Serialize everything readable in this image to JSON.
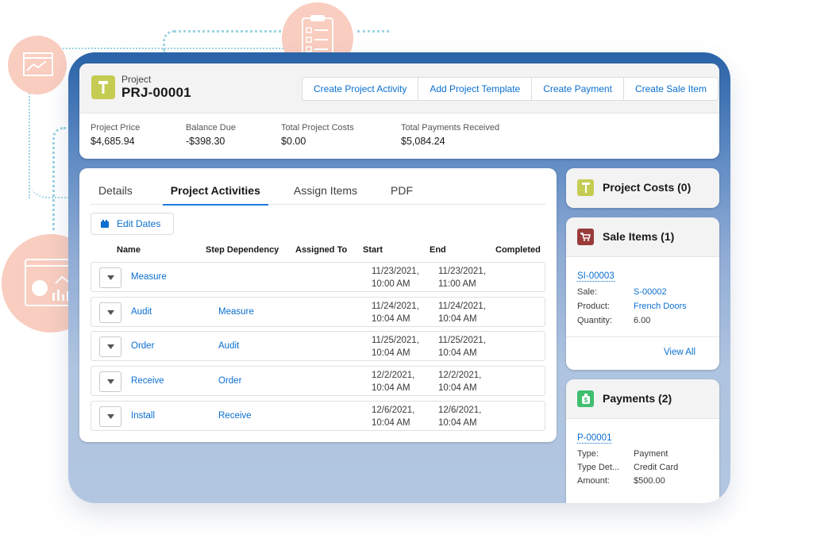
{
  "header": {
    "object_label": "Project",
    "record_name": "PRJ-00001",
    "actions": [
      "Create Project Activity",
      "Add Project Template",
      "Create Payment",
      "Create Sale Item"
    ],
    "fields": [
      {
        "label": "Project Price",
        "value": "$4,685.94"
      },
      {
        "label": "Balance Due",
        "value": "-$398.30"
      },
      {
        "label": "Total Project Costs",
        "value": "$0.00"
      },
      {
        "label": "Total Payments Received",
        "value": "$5,084.24"
      }
    ]
  },
  "tabs": [
    {
      "label": "Details",
      "active": false
    },
    {
      "label": "Project Activities",
      "active": true
    },
    {
      "label": "Assign Items",
      "active": false
    },
    {
      "label": "PDF",
      "active": false
    }
  ],
  "edit_dates_label": "Edit Dates",
  "table": {
    "columns": [
      "Name",
      "Step Dependency",
      "Assigned To",
      "Start",
      "End",
      "Completed"
    ],
    "rows": [
      {
        "name": "Measure",
        "dependency": "",
        "assigned_to": "",
        "start_date": "11/23/2021,",
        "start_time": "10:00 AM",
        "end_date": "11/23/2021,",
        "end_time": "11:00 AM",
        "completed": ""
      },
      {
        "name": "Audit",
        "dependency": "Measure",
        "assigned_to": "",
        "start_date": "11/24/2021,",
        "start_time": "10:04 AM",
        "end_date": "11/24/2021,",
        "end_time": "10:04 AM",
        "completed": ""
      },
      {
        "name": "Order",
        "dependency": "Audit",
        "assigned_to": "",
        "start_date": "11/25/2021,",
        "start_time": "10:04 AM",
        "end_date": "11/25/2021,",
        "end_time": "10:04 AM",
        "completed": ""
      },
      {
        "name": "Receive",
        "dependency": "Order",
        "assigned_to": "",
        "start_date": "12/2/2021,",
        "start_time": "10:04 AM",
        "end_date": "12/2/2021,",
        "end_time": "10:04 AM",
        "completed": ""
      },
      {
        "name": "Install",
        "dependency": "Receive",
        "assigned_to": "",
        "start_date": "12/6/2021,",
        "start_time": "10:04 AM",
        "end_date": "12/6/2021,",
        "end_time": "10:04 AM",
        "completed": ""
      }
    ]
  },
  "sidebar": {
    "project_costs": {
      "title": "Project Costs (0)",
      "icon": "hammer-icon",
      "color": "#c5cc52"
    },
    "sale_items": {
      "title": "Sale Items (1)",
      "icon": "cart-icon",
      "color": "#9a3b3b",
      "record_id": "SI-00003",
      "fields": [
        {
          "label": "Sale:",
          "value": "S-00002",
          "link": true
        },
        {
          "label": "Product:",
          "value": "French Doors",
          "link": true
        },
        {
          "label": "Quantity:",
          "value": "6.00",
          "link": false
        }
      ],
      "view_all": "View All"
    },
    "payments": {
      "title": "Payments (2)",
      "icon": "money-bag-icon",
      "color": "#3fbf6f",
      "record_id": "P-00001",
      "fields": [
        {
          "label": "Type:",
          "value": "Payment"
        },
        {
          "label": "Type Det...",
          "value": "Credit Card"
        },
        {
          "label": "Amount:",
          "value": "$500.00"
        }
      ]
    }
  },
  "colors": {
    "link": "#0b6fcf",
    "frame_top": "#2a63a8",
    "frame_bottom": "#b2c6e1",
    "deco": "#f9cdbf"
  }
}
